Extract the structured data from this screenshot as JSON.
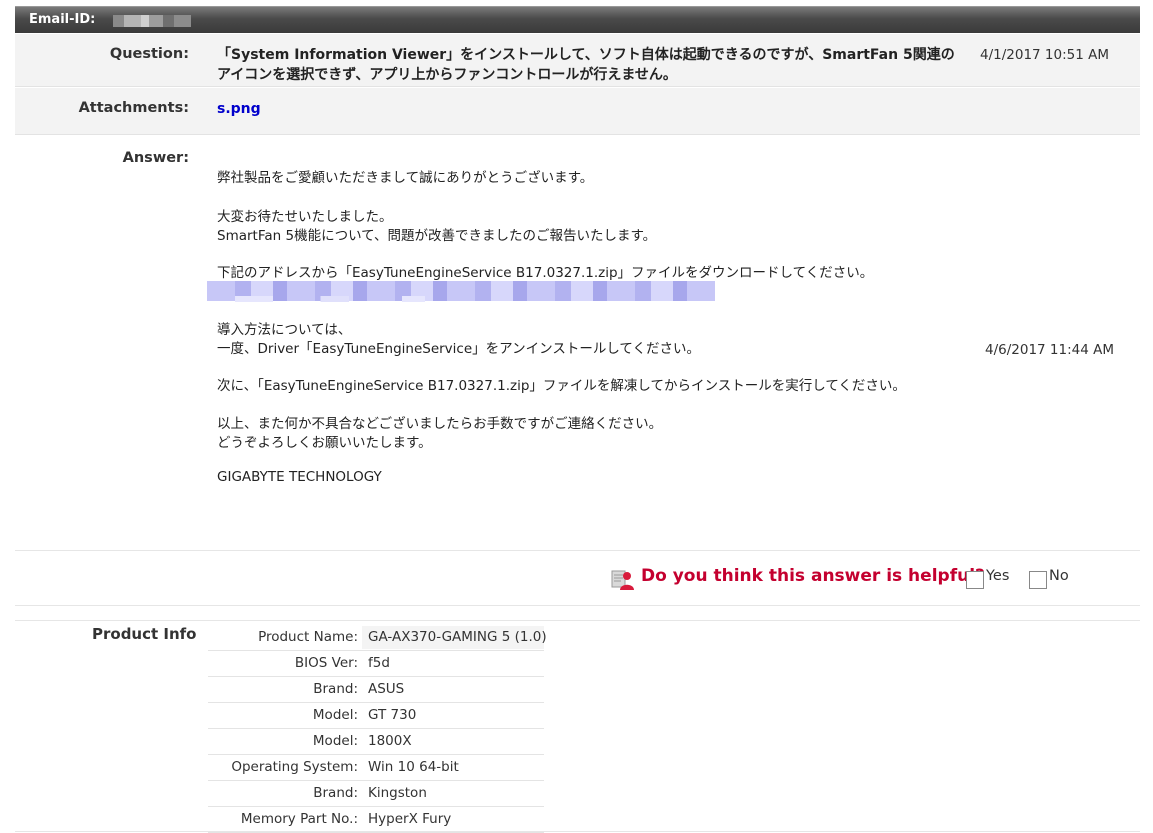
{
  "header": {
    "email_label": "Email-ID:"
  },
  "question": {
    "label": "Question:",
    "text": "「System Information Viewer」をインストールして、ソフト自体は起動できるのですが、SmartFan 5関連のアイコンを選択できず、アプリ上からファンコントロールが行えません。",
    "date": "4/1/2017 10:51 AM"
  },
  "attachments": {
    "label": "Attachments:",
    "file": "s.png"
  },
  "answer": {
    "label": "Answer:",
    "date": "4/6/2017 11:44 AM",
    "lines": [
      "弊社製品をご愛顧いただきまして誠にありがとうございます。",
      "大変お待たせいたしました。",
      "SmartFan 5機能について、問題が改善できましたのご報告いたします。",
      "下記のアドレスから「EasyTuneEngineService B17.0327.1.zip」ファイルをダウンロードしてください。",
      "導入方法については、",
      "一度、Driver「EasyTuneEngineService」をアンインストールしてください。",
      "次に、「EasyTuneEngineService B17.0327.1.zip」ファイルを解凍してからインストールを実行してください。",
      "以上、また何か不具合などございましたらお手数ですがご連絡ください。",
      "どうぞよろしくお願いいたします。",
      "GIGABYTE TECHNOLOGY"
    ]
  },
  "helpful": {
    "question": "Do you think this answer is helpful?",
    "yes": "Yes",
    "no": "No"
  },
  "product_info": {
    "title": "Product Info",
    "rows": [
      {
        "key": "Product Name:",
        "value": "GA-AX370-GAMING 5 (1.0)"
      },
      {
        "key": "BIOS Ver:",
        "value": "f5d"
      },
      {
        "key": "Brand:",
        "value": "ASUS"
      },
      {
        "key": "Model:",
        "value": "GT 730"
      },
      {
        "key": "Model:",
        "value": "1800X"
      },
      {
        "key": "Operating System:",
        "value": "Win 10 64-bit"
      },
      {
        "key": "Brand:",
        "value": "Kingston"
      },
      {
        "key": "Memory Part No.:",
        "value": "HyperX Fury"
      }
    ]
  },
  "colors": {
    "helpful_accent": "#c4002f",
    "link": "#0000cc",
    "header_bar": "#4a4a4a"
  }
}
